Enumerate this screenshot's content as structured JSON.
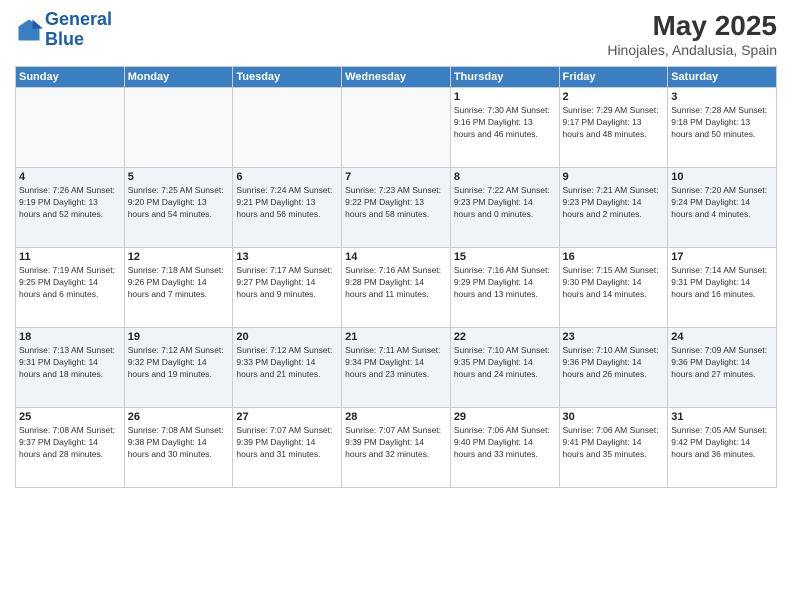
{
  "header": {
    "logo_line1": "General",
    "logo_line2": "Blue",
    "month": "May 2025",
    "location": "Hinojales, Andalusia, Spain"
  },
  "days_of_week": [
    "Sunday",
    "Monday",
    "Tuesday",
    "Wednesday",
    "Thursday",
    "Friday",
    "Saturday"
  ],
  "weeks": [
    [
      {
        "day": "",
        "info": "",
        "empty": true
      },
      {
        "day": "",
        "info": "",
        "empty": true
      },
      {
        "day": "",
        "info": "",
        "empty": true
      },
      {
        "day": "",
        "info": "",
        "empty": true
      },
      {
        "day": "1",
        "info": "Sunrise: 7:30 AM\nSunset: 9:16 PM\nDaylight: 13 hours\nand 46 minutes.",
        "empty": false
      },
      {
        "day": "2",
        "info": "Sunrise: 7:29 AM\nSunset: 9:17 PM\nDaylight: 13 hours\nand 48 minutes.",
        "empty": false
      },
      {
        "day": "3",
        "info": "Sunrise: 7:28 AM\nSunset: 9:18 PM\nDaylight: 13 hours\nand 50 minutes.",
        "empty": false
      }
    ],
    [
      {
        "day": "4",
        "info": "Sunrise: 7:26 AM\nSunset: 9:19 PM\nDaylight: 13 hours\nand 52 minutes.",
        "empty": false
      },
      {
        "day": "5",
        "info": "Sunrise: 7:25 AM\nSunset: 9:20 PM\nDaylight: 13 hours\nand 54 minutes.",
        "empty": false
      },
      {
        "day": "6",
        "info": "Sunrise: 7:24 AM\nSunset: 9:21 PM\nDaylight: 13 hours\nand 56 minutes.",
        "empty": false
      },
      {
        "day": "7",
        "info": "Sunrise: 7:23 AM\nSunset: 9:22 PM\nDaylight: 13 hours\nand 58 minutes.",
        "empty": false
      },
      {
        "day": "8",
        "info": "Sunrise: 7:22 AM\nSunset: 9:23 PM\nDaylight: 14 hours\nand 0 minutes.",
        "empty": false
      },
      {
        "day": "9",
        "info": "Sunrise: 7:21 AM\nSunset: 9:23 PM\nDaylight: 14 hours\nand 2 minutes.",
        "empty": false
      },
      {
        "day": "10",
        "info": "Sunrise: 7:20 AM\nSunset: 9:24 PM\nDaylight: 14 hours\nand 4 minutes.",
        "empty": false
      }
    ],
    [
      {
        "day": "11",
        "info": "Sunrise: 7:19 AM\nSunset: 9:25 PM\nDaylight: 14 hours\nand 6 minutes.",
        "empty": false
      },
      {
        "day": "12",
        "info": "Sunrise: 7:18 AM\nSunset: 9:26 PM\nDaylight: 14 hours\nand 7 minutes.",
        "empty": false
      },
      {
        "day": "13",
        "info": "Sunrise: 7:17 AM\nSunset: 9:27 PM\nDaylight: 14 hours\nand 9 minutes.",
        "empty": false
      },
      {
        "day": "14",
        "info": "Sunrise: 7:16 AM\nSunset: 9:28 PM\nDaylight: 14 hours\nand 11 minutes.",
        "empty": false
      },
      {
        "day": "15",
        "info": "Sunrise: 7:16 AM\nSunset: 9:29 PM\nDaylight: 14 hours\nand 13 minutes.",
        "empty": false
      },
      {
        "day": "16",
        "info": "Sunrise: 7:15 AM\nSunset: 9:30 PM\nDaylight: 14 hours\nand 14 minutes.",
        "empty": false
      },
      {
        "day": "17",
        "info": "Sunrise: 7:14 AM\nSunset: 9:31 PM\nDaylight: 14 hours\nand 16 minutes.",
        "empty": false
      }
    ],
    [
      {
        "day": "18",
        "info": "Sunrise: 7:13 AM\nSunset: 9:31 PM\nDaylight: 14 hours\nand 18 minutes.",
        "empty": false
      },
      {
        "day": "19",
        "info": "Sunrise: 7:12 AM\nSunset: 9:32 PM\nDaylight: 14 hours\nand 19 minutes.",
        "empty": false
      },
      {
        "day": "20",
        "info": "Sunrise: 7:12 AM\nSunset: 9:33 PM\nDaylight: 14 hours\nand 21 minutes.",
        "empty": false
      },
      {
        "day": "21",
        "info": "Sunrise: 7:11 AM\nSunset: 9:34 PM\nDaylight: 14 hours\nand 23 minutes.",
        "empty": false
      },
      {
        "day": "22",
        "info": "Sunrise: 7:10 AM\nSunset: 9:35 PM\nDaylight: 14 hours\nand 24 minutes.",
        "empty": false
      },
      {
        "day": "23",
        "info": "Sunrise: 7:10 AM\nSunset: 9:36 PM\nDaylight: 14 hours\nand 26 minutes.",
        "empty": false
      },
      {
        "day": "24",
        "info": "Sunrise: 7:09 AM\nSunset: 9:36 PM\nDaylight: 14 hours\nand 27 minutes.",
        "empty": false
      }
    ],
    [
      {
        "day": "25",
        "info": "Sunrise: 7:08 AM\nSunset: 9:37 PM\nDaylight: 14 hours\nand 28 minutes.",
        "empty": false
      },
      {
        "day": "26",
        "info": "Sunrise: 7:08 AM\nSunset: 9:38 PM\nDaylight: 14 hours\nand 30 minutes.",
        "empty": false
      },
      {
        "day": "27",
        "info": "Sunrise: 7:07 AM\nSunset: 9:39 PM\nDaylight: 14 hours\nand 31 minutes.",
        "empty": false
      },
      {
        "day": "28",
        "info": "Sunrise: 7:07 AM\nSunset: 9:39 PM\nDaylight: 14 hours\nand 32 minutes.",
        "empty": false
      },
      {
        "day": "29",
        "info": "Sunrise: 7:06 AM\nSunset: 9:40 PM\nDaylight: 14 hours\nand 33 minutes.",
        "empty": false
      },
      {
        "day": "30",
        "info": "Sunrise: 7:06 AM\nSunset: 9:41 PM\nDaylight: 14 hours\nand 35 minutes.",
        "empty": false
      },
      {
        "day": "31",
        "info": "Sunrise: 7:05 AM\nSunset: 9:42 PM\nDaylight: 14 hours\nand 36 minutes.",
        "empty": false
      }
    ]
  ]
}
